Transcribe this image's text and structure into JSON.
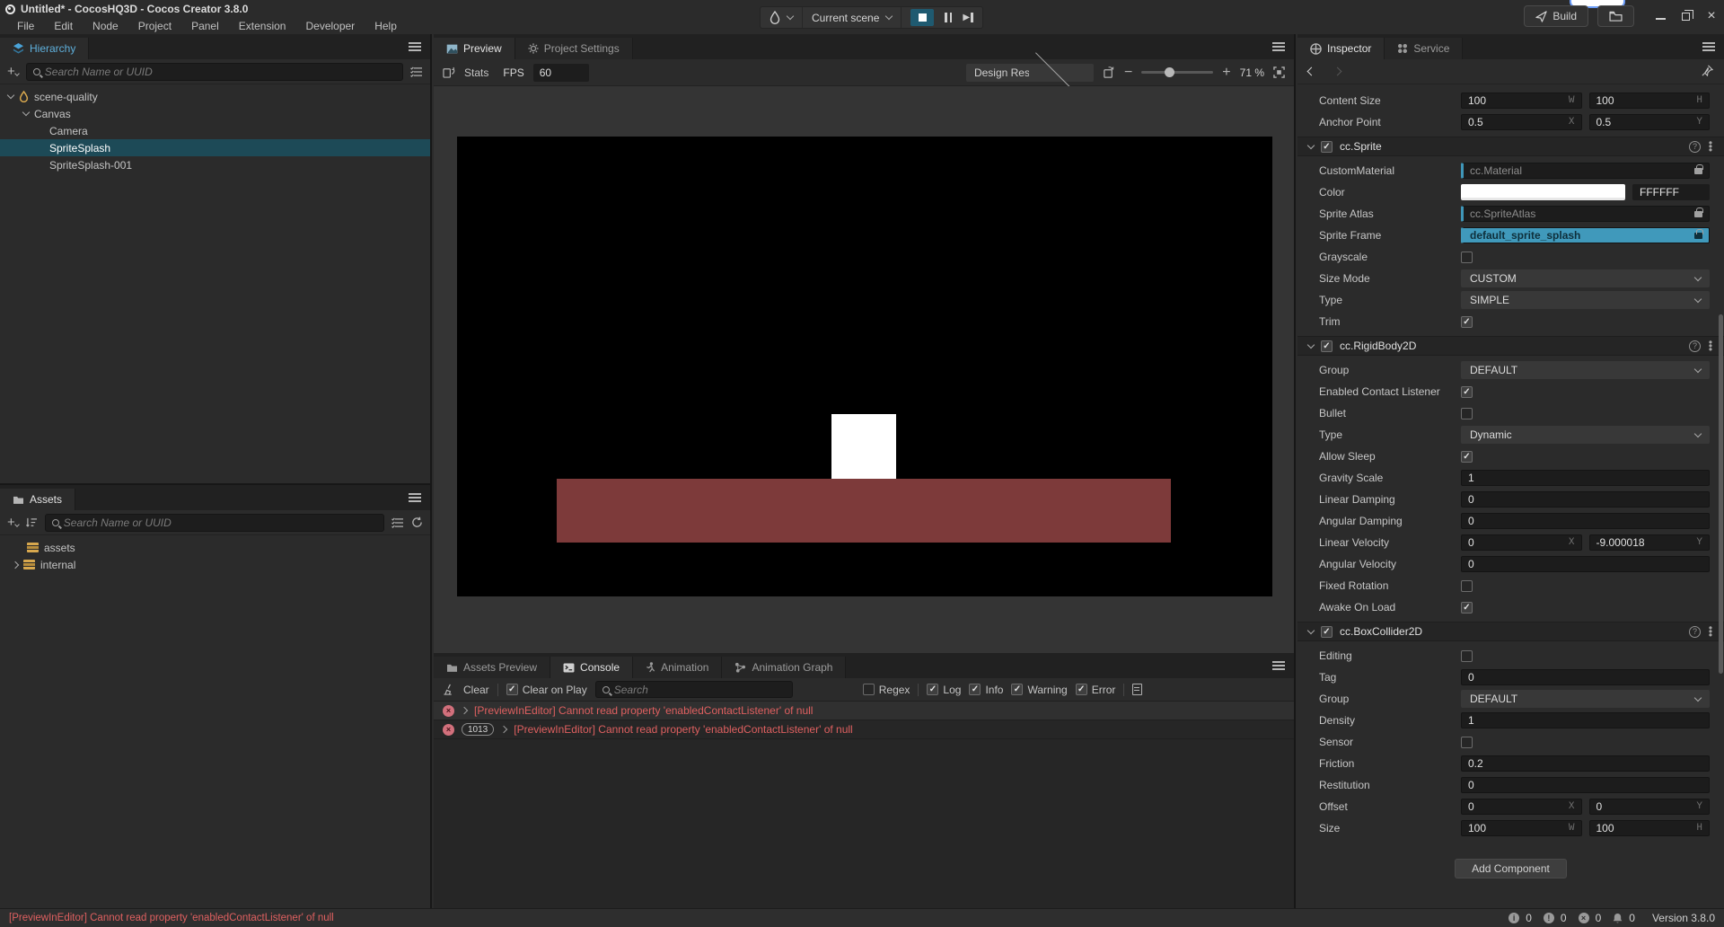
{
  "titlebar": {
    "title": "Untitled* - CocosHQ3D - Cocos Creator 3.8.0",
    "menus": [
      "File",
      "Edit",
      "Node",
      "Project",
      "Panel",
      "Extension",
      "Developer",
      "Help"
    ],
    "scene_selector": "Current scene",
    "build_label": "Build"
  },
  "hierarchy": {
    "tab": "Hierarchy",
    "search_placeholder": "Search Name or UUID",
    "tree": [
      {
        "label": "scene-quality"
      },
      {
        "label": "Canvas"
      },
      {
        "label": "Camera"
      },
      {
        "label": "SpriteSplash",
        "selected": true
      },
      {
        "label": "SpriteSplash-001"
      }
    ]
  },
  "assets": {
    "tab": "Assets",
    "search_placeholder": "Search Name or UUID",
    "tree": [
      {
        "label": "assets"
      },
      {
        "label": "internal"
      }
    ]
  },
  "preview": {
    "tab_preview": "Preview",
    "tab_project_settings": "Project Settings",
    "stats_label": "Stats",
    "fps_label": "FPS",
    "fps_value": "60",
    "resolution_dropdown": "Design Resolution (...",
    "zoom_percent": "71 %",
    "game": {
      "background": "#000000",
      "square_color": "#ffffff",
      "platform_color": "#7d3a3a"
    }
  },
  "console": {
    "tab_assets_preview": "Assets Preview",
    "tab_console": "Console",
    "tab_animation": "Animation",
    "tab_animation_graph": "Animation Graph",
    "toolbar": {
      "clear": "Clear",
      "clear_on_play": "Clear on Play",
      "search_placeholder": "Search",
      "regex": "Regex",
      "log": "Log",
      "info": "Info",
      "warning": "Warning",
      "error": "Error"
    },
    "messages": [
      {
        "count": "",
        "text": "[PreviewInEditor] Cannot read property 'enabledContactListener' of null"
      },
      {
        "count": "1013",
        "text": "[PreviewInEditor] Cannot read property 'enabledContactListener' of null"
      }
    ]
  },
  "inspector": {
    "tab_inspector": "Inspector",
    "tab_service": "Service",
    "node": {
      "content_size": {
        "label": "Content Size",
        "v1": "100",
        "s1": "W",
        "v2": "100",
        "s2": "H"
      },
      "anchor_point": {
        "label": "Anchor Point",
        "v1": "0.5",
        "s1": "X",
        "v2": "0.5",
        "s2": "Y"
      }
    },
    "sprite": {
      "title": "cc.Sprite",
      "custom_material": {
        "label": "CustomMaterial",
        "value": "cc.Material"
      },
      "color": {
        "label": "Color",
        "hex": "FFFFFF",
        "swatch": "#ffffff"
      },
      "sprite_atlas": {
        "label": "Sprite Atlas",
        "value": "cc.SpriteAtlas"
      },
      "sprite_frame": {
        "label": "Sprite Frame",
        "value": "default_sprite_splash"
      },
      "grayscale": {
        "label": "Grayscale",
        "checked": false
      },
      "size_mode": {
        "label": "Size Mode",
        "value": "CUSTOM"
      },
      "type": {
        "label": "Type",
        "value": "SIMPLE"
      },
      "trim": {
        "label": "Trim",
        "checked": true
      }
    },
    "rigidbody": {
      "title": "cc.RigidBody2D",
      "group": {
        "label": "Group",
        "value": "DEFAULT"
      },
      "enabled_contact_listener": {
        "label": "Enabled Contact Listener",
        "checked": true
      },
      "bullet": {
        "label": "Bullet",
        "checked": false
      },
      "type": {
        "label": "Type",
        "value": "Dynamic"
      },
      "allow_sleep": {
        "label": "Allow Sleep",
        "checked": true
      },
      "gravity_scale": {
        "label": "Gravity Scale",
        "value": "1"
      },
      "linear_damping": {
        "label": "Linear Damping",
        "value": "0"
      },
      "angular_damping": {
        "label": "Angular Damping",
        "value": "0"
      },
      "linear_velocity": {
        "label": "Linear Velocity",
        "v1": "0",
        "s1": "X",
        "v2": "-9.000018",
        "s2": "Y"
      },
      "angular_velocity": {
        "label": "Angular Velocity",
        "value": "0"
      },
      "fixed_rotation": {
        "label": "Fixed Rotation",
        "checked": false
      },
      "awake_on_load": {
        "label": "Awake On Load",
        "checked": true
      }
    },
    "collider": {
      "title": "cc.BoxCollider2D",
      "editing": {
        "label": "Editing",
        "checked": false
      },
      "tag": {
        "label": "Tag",
        "value": "0"
      },
      "group": {
        "label": "Group",
        "value": "DEFAULT"
      },
      "density": {
        "label": "Density",
        "value": "1"
      },
      "sensor": {
        "label": "Sensor",
        "checked": false
      },
      "friction": {
        "label": "Friction",
        "value": "0.2"
      },
      "restitution": {
        "label": "Restitution",
        "value": "0"
      },
      "offset": {
        "label": "Offset",
        "v1": "0",
        "s1": "X",
        "v2": "0",
        "s2": "Y"
      },
      "size": {
        "label": "Size",
        "v1": "100",
        "s1": "W",
        "v2": "100",
        "s2": "H"
      }
    },
    "add_component": "Add Component"
  },
  "statusbar": {
    "message": "[PreviewInEditor] Cannot read property 'enabledContactListener' of null",
    "info_count": "0",
    "warning_count": "0",
    "error_count": "0",
    "bell_count": "0",
    "version": "Version 3.8.0"
  }
}
